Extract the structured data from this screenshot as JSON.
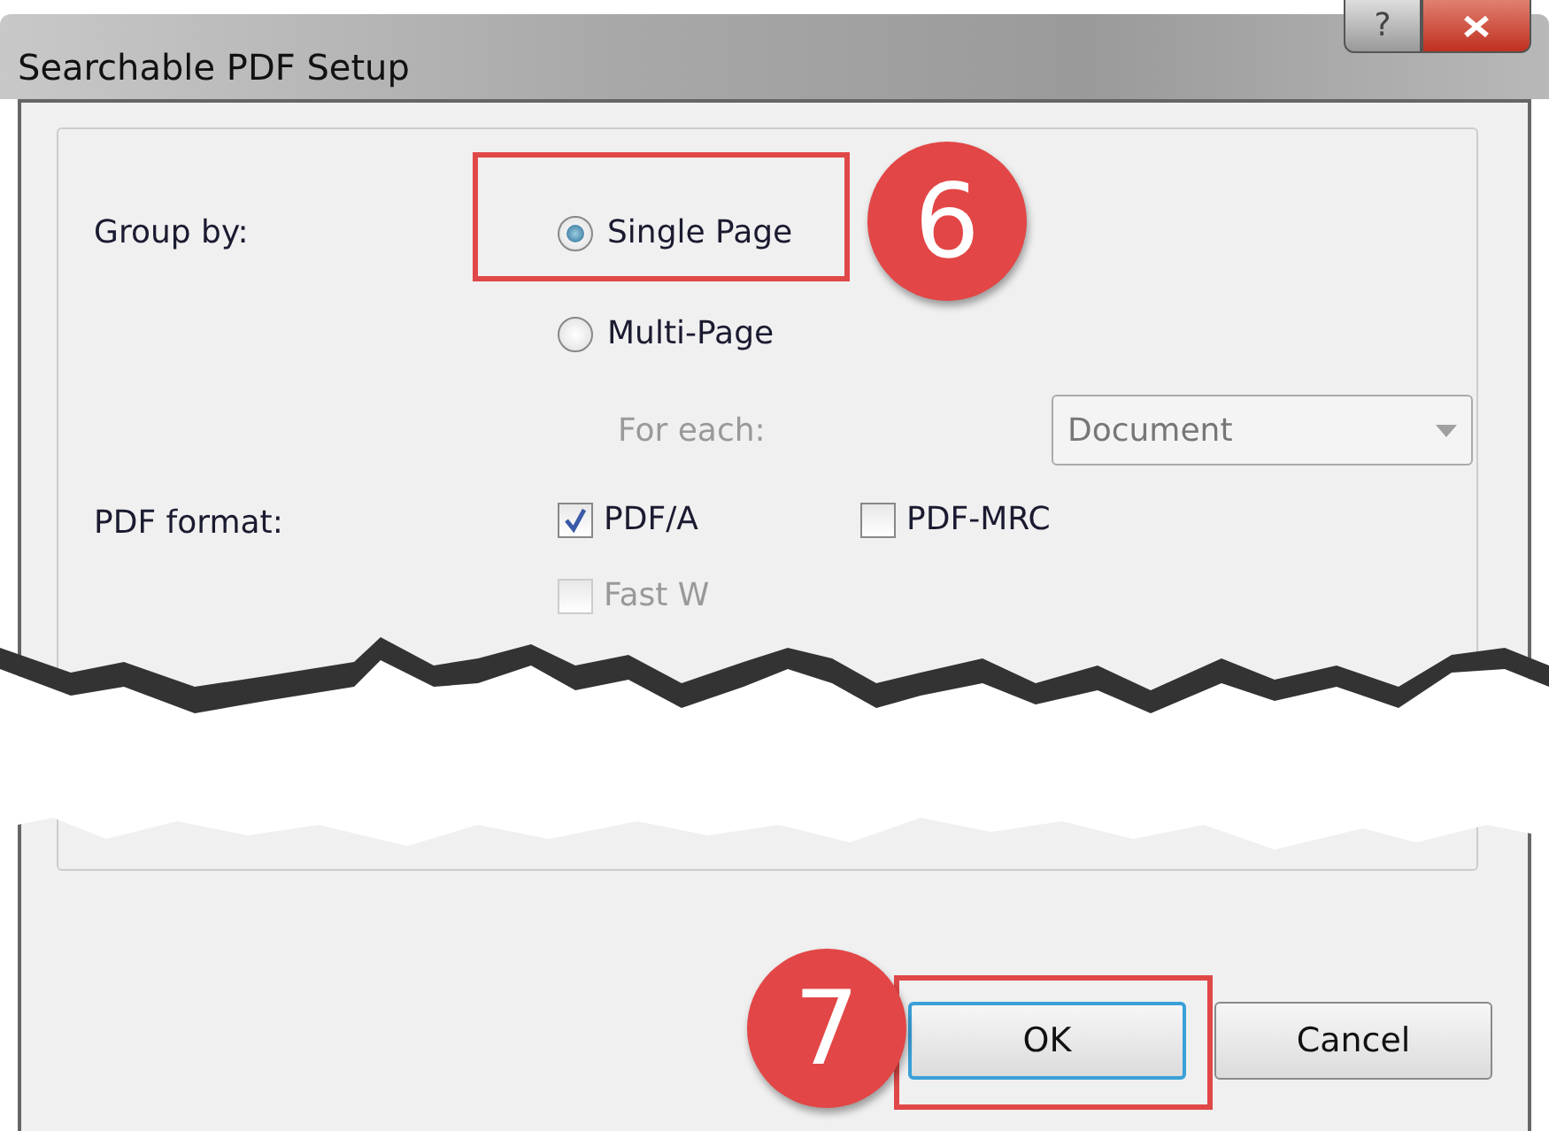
{
  "window": {
    "title": "Searchable PDF Setup",
    "help_button": "?"
  },
  "group_by": {
    "label": "Group by:",
    "options": [
      {
        "label": "Single Page",
        "selected": true
      },
      {
        "label": "Multi-Page",
        "selected": false
      }
    ],
    "for_each": {
      "label": "For each:",
      "value": "Document",
      "disabled": true
    }
  },
  "pdf_format": {
    "label": "PDF format:",
    "options": [
      {
        "label": "PDF/A",
        "checked": true,
        "disabled": false
      },
      {
        "label": "PDF-MRC",
        "checked": false,
        "disabled": false
      },
      {
        "label": "Fast W",
        "checked": false,
        "disabled": true
      }
    ]
  },
  "buttons": [
    {
      "label": "OK",
      "default": true
    },
    {
      "label": "Cancel",
      "default": false
    }
  ],
  "callouts": [
    {
      "number": "6"
    },
    {
      "number": "7"
    }
  ]
}
